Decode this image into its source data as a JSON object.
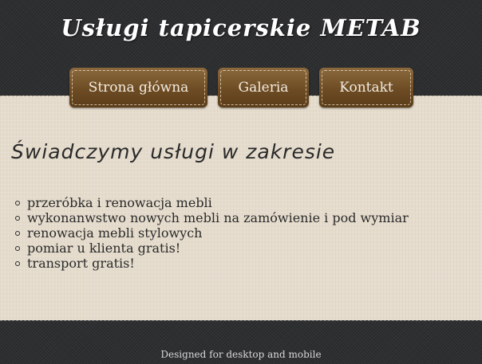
{
  "header": {
    "title": "Usługi tapicerskie METAB"
  },
  "nav": {
    "items": [
      {
        "label": "Strona główna"
      },
      {
        "label": "Galeria"
      },
      {
        "label": "Kontakt"
      }
    ]
  },
  "main": {
    "heading": "Świadczymy usługi w zakresie",
    "services": [
      "przeróbka i renowacja mebli",
      "wykonanwstwo nowych mebli na zamówienie i pod wymiar",
      "renowacja mebli stylowych",
      "pomiar u klienta gratis!",
      "transport gratis!"
    ]
  },
  "footer": {
    "text": "Designed for desktop and mobile"
  },
  "colors": {
    "header_bg": "#2e2f31",
    "content_bg": "#e5dccd",
    "button_brown": "#6d4c24",
    "button_text": "#f3ebe0"
  }
}
